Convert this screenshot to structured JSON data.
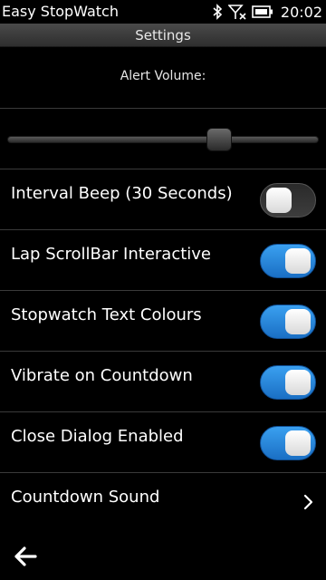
{
  "status_bar": {
    "app_name": "Easy StopWatch",
    "time": "20:02",
    "icons": [
      "bluetooth-icon",
      "signal-off-icon",
      "battery-icon"
    ]
  },
  "header": {
    "title": "Settings"
  },
  "alert_volume": {
    "label": "Alert Volume:",
    "value_fraction": 0.68
  },
  "settings": [
    {
      "label": "Interval Beep (30 Seconds)",
      "type": "toggle",
      "on": false
    },
    {
      "label": "Lap ScrollBar Interactive",
      "type": "toggle",
      "on": true
    },
    {
      "label": "Stopwatch Text Colours",
      "type": "toggle",
      "on": true
    },
    {
      "label": "Vibrate on Countdown",
      "type": "toggle",
      "on": true
    },
    {
      "label": "Close Dialog Enabled",
      "type": "toggle",
      "on": true
    },
    {
      "label": "Countdown Sound",
      "type": "link",
      "icon": "chevron-right-icon"
    }
  ],
  "footer": {
    "back_icon": "back-arrow-icon"
  },
  "colors": {
    "toggle_on": "#2a8be0",
    "toggle_off": "#333333",
    "background": "#000000"
  }
}
